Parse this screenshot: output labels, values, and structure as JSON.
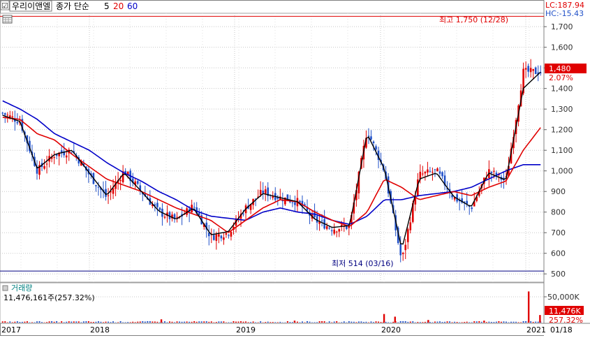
{
  "header": {
    "checkbox": "☑",
    "stock_name": "우리이앤엘",
    "ma_label": "종가 단순",
    "ma_periods": [
      "5",
      "20",
      "60"
    ],
    "ma_colors": [
      "#000000",
      "#e00000",
      "#0000c8"
    ],
    "settings_icon": "grid-icon"
  },
  "top_right": {
    "lc": "LC:187.94",
    "hc": "HC:-15.43"
  },
  "price_axis": {
    "ticks": [
      "1,700",
      "1,600",
      "1,500",
      "1,400",
      "1,300",
      "1,200",
      "1,100",
      "1,000",
      "900",
      "800",
      "700",
      "600",
      "500"
    ],
    "current_price": "1,480",
    "change_pct": "2.07%"
  },
  "annotations": {
    "high": "최고 1,750 (12/28)",
    "low": "최저 514 (03/16)"
  },
  "volume_panel": {
    "title": "거래량",
    "value_text": "11,476,161주(257.32%)",
    "axis_tick": "50,000K",
    "current_volume": "11,476K",
    "current_pct": "257.32%"
  },
  "x_axis": {
    "labels": [
      "2017",
      "2018",
      "2019",
      "2020",
      "2021",
      "01/18"
    ]
  },
  "colors": {
    "up": "#e00000",
    "down": "#2050c8",
    "ma5": "#000000",
    "ma20": "#e00000",
    "ma60": "#0000c8",
    "high_line": "#e00000",
    "low_line": "#000080",
    "grid": "#c8c8c8"
  },
  "chart_data": {
    "type": "candlestick",
    "price_range": [
      460,
      1765
    ],
    "volume_range": [
      0,
      60000
    ],
    "high": 1750,
    "low": 514,
    "x_dates": [
      "2017-01",
      "2017-04",
      "2017-07",
      "2017-10",
      "2018-01",
      "2018-04",
      "2018-07",
      "2018-10",
      "2019-01",
      "2019-04",
      "2019-07",
      "2019-10",
      "2019-11",
      "2019-12",
      "2020-01",
      "2020-02",
      "2020-03",
      "2020-04",
      "2020-06",
      "2020-08",
      "2020-10",
      "2020-12",
      "2021-01"
    ],
    "close_path": [
      1280,
      1240,
      1000,
      1080,
      1100,
      980,
      870,
      1000,
      900,
      800,
      760,
      830,
      680,
      700,
      820,
      900,
      870,
      850,
      760,
      720,
      730,
      1200,
      1000,
      560,
      980,
      1000,
      870,
      820,
      1000,
      950,
      1480,
      1480
    ],
    "ma5": [
      1270,
      1240,
      1010,
      1080,
      1100,
      990,
      880,
      990,
      900,
      805,
      765,
      820,
      690,
      705,
      815,
      890,
      870,
      850,
      765,
      725,
      735,
      1180,
      1010,
      620,
      960,
      990,
      875,
      825,
      990,
      955,
      1400,
      1480
    ],
    "ma20": [
      1260,
      1250,
      1180,
      1150,
      1080,
      1020,
      960,
      930,
      900,
      860,
      820,
      790,
      760,
      700,
      760,
      820,
      860,
      850,
      800,
      760,
      730,
      800,
      960,
      920,
      860,
      880,
      900,
      880,
      920,
      950,
      1100,
      1210
    ],
    "ma60": [
      1340,
      1300,
      1250,
      1180,
      1140,
      1100,
      1040,
      990,
      950,
      900,
      860,
      810,
      780,
      770,
      760,
      800,
      820,
      800,
      790,
      760,
      740,
      780,
      860,
      860,
      880,
      890,
      900,
      920,
      960,
      1000,
      1030,
      1030
    ],
    "volume_spikes": [
      {
        "date": "2018-03",
        "value": 5000
      },
      {
        "date": "2019-03",
        "value": 3000
      },
      {
        "date": "2019-11",
        "value": 13000
      },
      {
        "date": "2019-12",
        "value": 9000
      },
      {
        "date": "2020-03",
        "value": 4000
      },
      {
        "date": "2020-08",
        "value": 3000
      },
      {
        "date": "2020-12",
        "value": 47000
      },
      {
        "date": "2021-01",
        "value": 11476
      }
    ]
  }
}
